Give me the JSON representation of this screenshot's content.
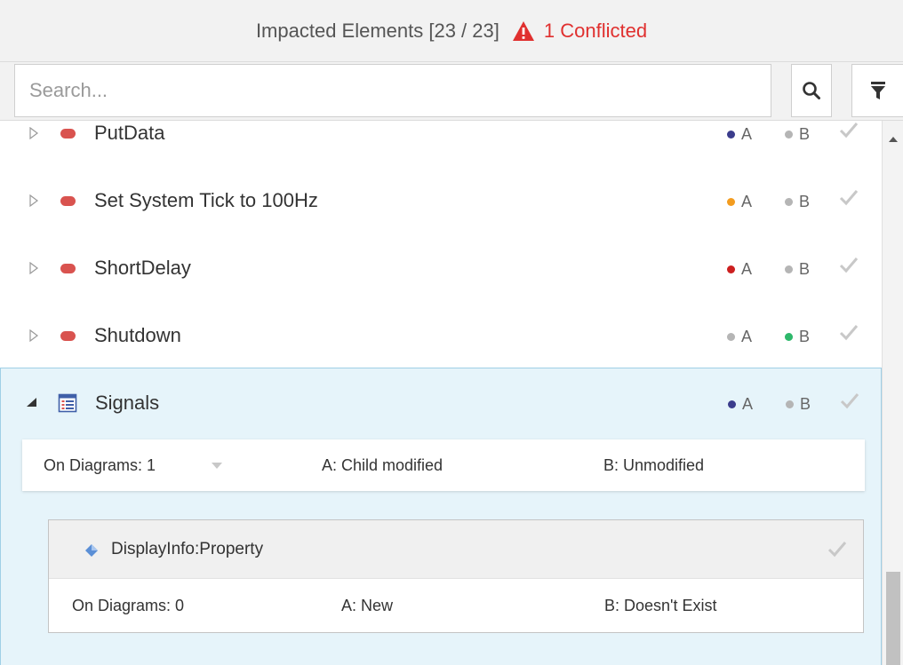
{
  "header": {
    "title": "Impacted Elements [23 / 23]",
    "conflict_label": "1 Conflicted",
    "conflict_color": "#e0302f"
  },
  "search": {
    "placeholder": "Search...",
    "value": "",
    "search_icon": "search-icon",
    "filter_icon": "filter-icon"
  },
  "colors": {
    "dot_navy": "#3b3c8c",
    "dot_orange": "#f39c1f",
    "dot_red": "#cc1f1f",
    "dot_gray": "#b5b5b5",
    "dot_green": "#2eb86b",
    "selected_bg": "#e6f4fa",
    "pill": "#d9534f"
  },
  "rows": [
    {
      "label": "PutData",
      "a": "A",
      "b": "B",
      "a_color": "#3b3c8c",
      "b_color": "#b5b5b5"
    },
    {
      "label": "Set System Tick to 100Hz",
      "a": "A",
      "b": "B",
      "a_color": "#f39c1f",
      "b_color": "#b5b5b5"
    },
    {
      "label": "ShortDelay",
      "a": "A",
      "b": "B",
      "a_color": "#cc1f1f",
      "b_color": "#b5b5b5"
    },
    {
      "label": "Shutdown",
      "a": "A",
      "b": "B",
      "a_color": "#b5b5b5",
      "b_color": "#2eb86b"
    }
  ],
  "signals": {
    "label": "Signals",
    "a": "A",
    "b": "B",
    "a_color": "#3b3c8c",
    "b_color": "#b5b5b5",
    "on_diagrams": "On Diagrams: 1",
    "a_status": "A: Child modified",
    "b_status": "B: Unmodified",
    "child": {
      "label": "DisplayInfo:Property",
      "on_diagrams": "On Diagrams: 0",
      "a_status": "A: New",
      "b_status": "B: Doesn't Exist"
    }
  }
}
